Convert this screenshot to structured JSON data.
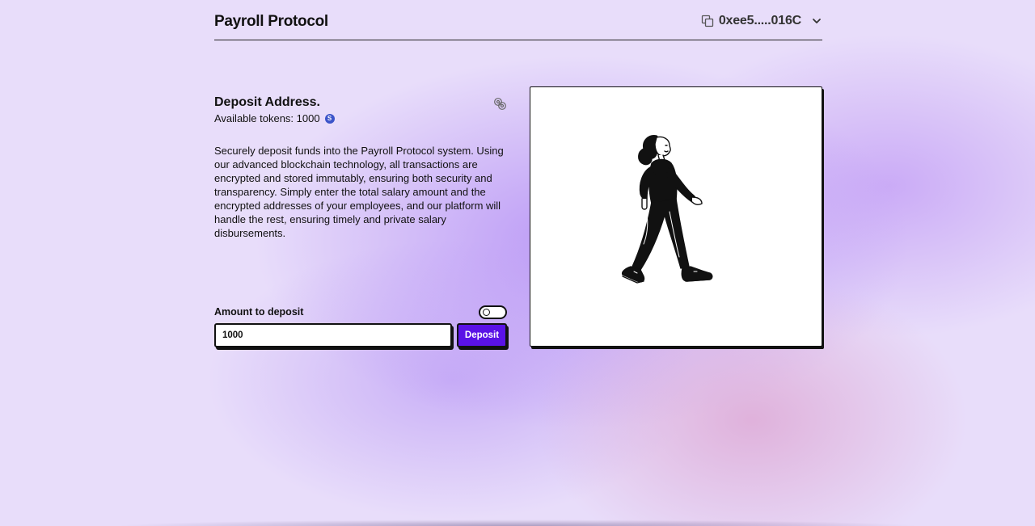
{
  "header": {
    "app_title": "Payroll Protocol",
    "wallet_address": "0xee5.....016C"
  },
  "deposit": {
    "title": "Deposit Address.",
    "available_label": "Available tokens: 1000",
    "token_symbol": "S",
    "description": "Securely deposit funds into the Payroll Protocol system. Using our advanced blockchain technology, all transactions are encrypted and stored immutably, ensuring both security and transparency. Simply enter the total salary amount and the encrypted addresses of your employees, and our platform will handle the rest, ensuring timely and private salary disbursements.",
    "amount_label": "Amount to deposit",
    "amount_value": "1000",
    "deposit_button": "Deposit"
  },
  "colors": {
    "accent": "#5a12e6",
    "token_badge": "#3b54c9"
  },
  "icons": [
    "copy-icon",
    "chevron-down-icon",
    "link-icon",
    "token-icon",
    "toggle-switch"
  ]
}
